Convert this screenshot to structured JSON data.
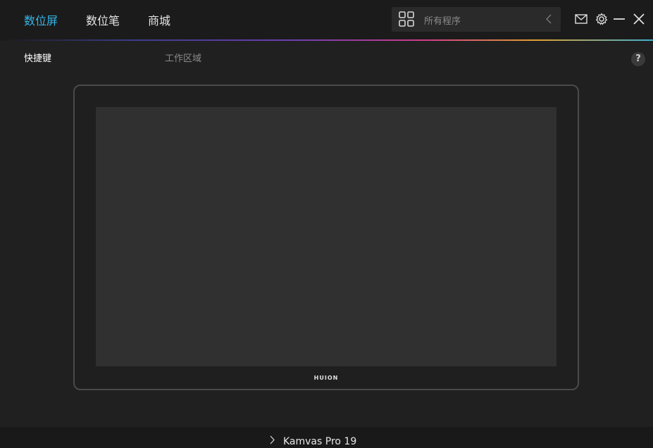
{
  "header": {
    "tabs": [
      {
        "label": "数位屏",
        "active": true
      },
      {
        "label": "数位笔",
        "active": false
      },
      {
        "label": "商城",
        "active": false
      }
    ],
    "program_selector": {
      "placeholder": "所有程序",
      "icon": "grid-icon",
      "back_icon": "chevron-left-icon"
    },
    "icons": [
      "mail-icon",
      "gear-icon",
      "minimize-icon",
      "close-icon"
    ],
    "accent_color": "#35b6e8"
  },
  "subtabs": [
    {
      "label": "快捷键",
      "active": true
    },
    {
      "label": "工作区域",
      "active": false
    }
  ],
  "help": {
    "label": "?"
  },
  "tablet": {
    "logo": "HUION"
  },
  "footer": {
    "device_name": "Kamvas Pro 19",
    "icon": "chevron-right-icon"
  }
}
